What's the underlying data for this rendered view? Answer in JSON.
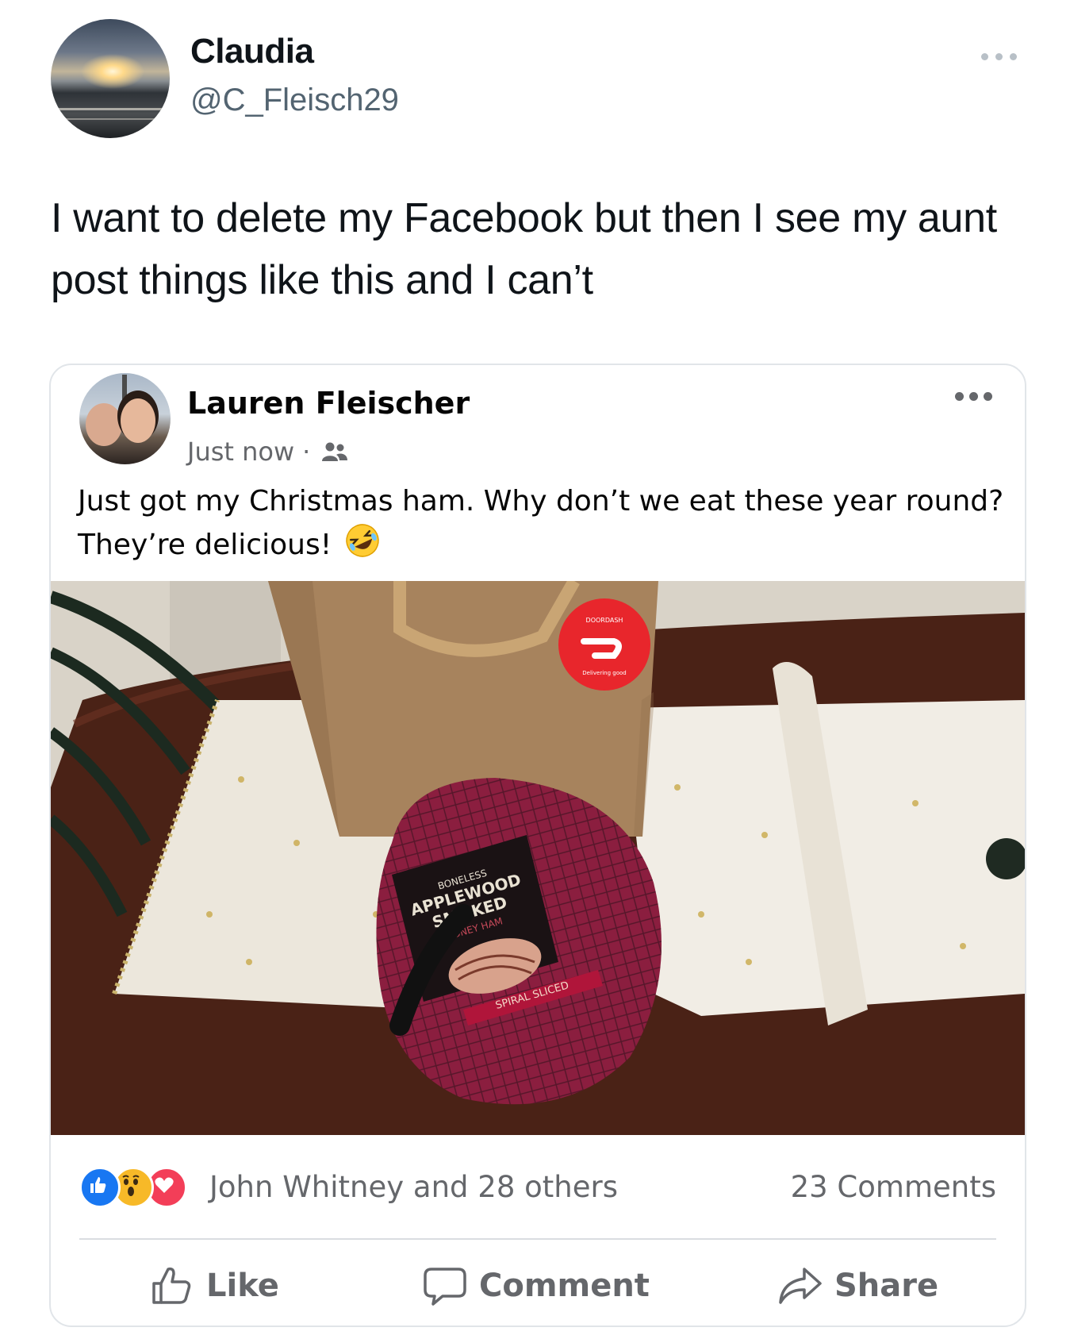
{
  "tweet": {
    "display_name": "Claudia",
    "handle": "@C_Fleisch29",
    "text": "I want to delete my Facebook but then I see my aunt post things like this and I can’t"
  },
  "fb_post": {
    "author": "Lauren Fleischer",
    "timestamp": "Just now",
    "separator": "·",
    "audience_icon": "friends-icon",
    "text": "Just got my Christmas ham. Why don’t we eat these year round? They’re delicious!",
    "emoji": "rolling-on-floor-laughing-emoji",
    "photo": {
      "bag_sticker_top": "DOORDASH",
      "bag_sticker_bottom": "Delivering good",
      "ham_label_line1": "BONELESS",
      "ham_label_line2": "APPLEWOOD",
      "ham_label_line3": "SMOKED",
      "ham_label_line4": "HONEY HAM",
      "ham_label_band": "SPIRAL SLICED"
    },
    "reactions": [
      "like",
      "wow",
      "love"
    ],
    "reaction_summary": "John Whitney and 28 others",
    "comments_count": "23 Comments",
    "actions": {
      "like": "Like",
      "comment": "Comment",
      "share": "Share"
    }
  },
  "colors": {
    "tweet_text": "#0f1419",
    "handle": "#536471",
    "fb_blue": "#1877f2",
    "fb_secondary_text": "#65676b",
    "card_border": "#e1e5e9"
  }
}
